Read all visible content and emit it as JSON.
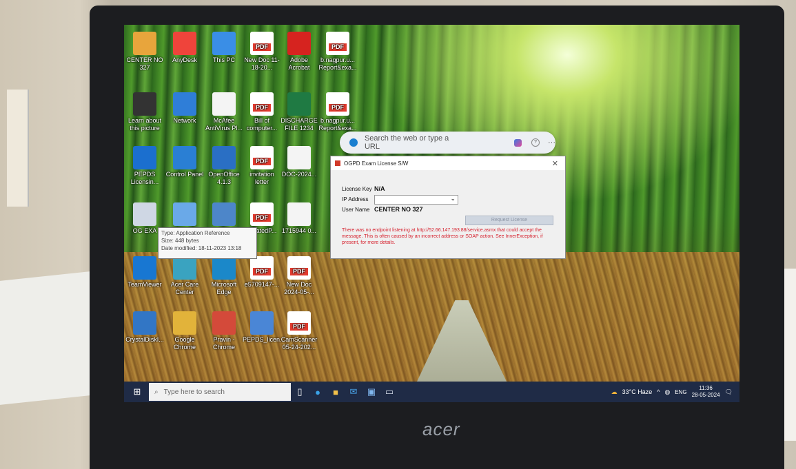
{
  "desktop_icons": [
    {
      "label": "CENTER NO 327",
      "kind": "folder",
      "color": "#e8a53c"
    },
    {
      "label": "AnyDesk",
      "kind": "app",
      "color": "#ef443b"
    },
    {
      "label": "This PC",
      "kind": "app",
      "color": "#3a8ee6"
    },
    {
      "label": "New Doc 11-18-20...",
      "kind": "pdf"
    },
    {
      "label": "Adobe Acrobat",
      "kind": "app",
      "color": "#d6231f"
    },
    {
      "label": "b.nagpur.u... Report&exa...",
      "kind": "pdf"
    },
    {
      "label": "Learn about this picture",
      "kind": "app",
      "color": "#333333"
    },
    {
      "label": "Network",
      "kind": "app",
      "color": "#2f7ed8"
    },
    {
      "label": "McAfee AntiVirus Pl...",
      "kind": "doc"
    },
    {
      "label": "Bill of computer...",
      "kind": "pdf"
    },
    {
      "label": "DISCHARGE FILE 1234",
      "kind": "app",
      "color": "#1f7a43"
    },
    {
      "label": "b.nagpur.u... Report&exa...",
      "kind": "pdf"
    },
    {
      "label": "PEPDS Licensin...",
      "kind": "app",
      "color": "#1b6fcf"
    },
    {
      "label": "Control Panel",
      "kind": "app",
      "color": "#2a7fd4"
    },
    {
      "label": "OpenOffice 4.1.3",
      "kind": "app",
      "color": "#2a6fc4"
    },
    {
      "label": "invitation letter",
      "kind": "pdf"
    },
    {
      "label": "DOC-2024...",
      "kind": "doc"
    },
    {
      "label": "OG EXA",
      "kind": "app",
      "color": "#cfd7e4"
    },
    {
      "label": "",
      "kind": "app",
      "color": "#6aa9e8"
    },
    {
      "label": "",
      "kind": "app",
      "color": "#4d86c9"
    },
    {
      "label": "neratedP...",
      "kind": "pdf"
    },
    {
      "label": "1715944 0...",
      "kind": "doc"
    },
    {
      "label": "TeamViewer",
      "kind": "app",
      "color": "#1877d2"
    },
    {
      "label": "Acer Care Center",
      "kind": "app",
      "color": "#3aa3c0"
    },
    {
      "label": "Microsoft Edge",
      "kind": "app",
      "color": "#1b88c9"
    },
    {
      "label": "e5709147-...",
      "kind": "pdf"
    },
    {
      "label": "New Doc 2024-05-...",
      "kind": "pdf"
    },
    {
      "label": "CrystalDiskI...",
      "kind": "app",
      "color": "#3276c5"
    },
    {
      "label": "Google Chrome",
      "kind": "app",
      "color": "#e2b33a"
    },
    {
      "label": "Pravin - Chrome",
      "kind": "app",
      "color": "#d44a3a"
    },
    {
      "label": "PEPDS_licen...",
      "kind": "app",
      "color": "#4a86d6"
    },
    {
      "label": "CamScanner 05-24-202...",
      "kind": "pdf"
    }
  ],
  "tooltip": {
    "type": "Type: Application Reference",
    "size": "Size: 448 bytes",
    "date": "Date modified: 18-11-2023 13:18"
  },
  "edge_bar": {
    "placeholder": "Search the web or type a URL"
  },
  "dialog": {
    "title": "OGPD Exam License S/W",
    "license_key_label": "License Key",
    "license_key_value": "N/A",
    "ip_label": "IP Address",
    "ip_value": "",
    "user_label": "User Name",
    "user_value": "CENTER NO 327",
    "button": "Request License",
    "error": "There was no endpoint listening at http://52.66.147.193:88/service.asmx that could accept the message. This is often caused by an incorrect address or SOAP action. See InnerException, if present, for more details."
  },
  "taskbar": {
    "search_placeholder": "Type here to search",
    "weather": "33°C Haze",
    "lang": "ENG",
    "time": "11:36",
    "date": "28-05-2024"
  },
  "brand": "acer"
}
